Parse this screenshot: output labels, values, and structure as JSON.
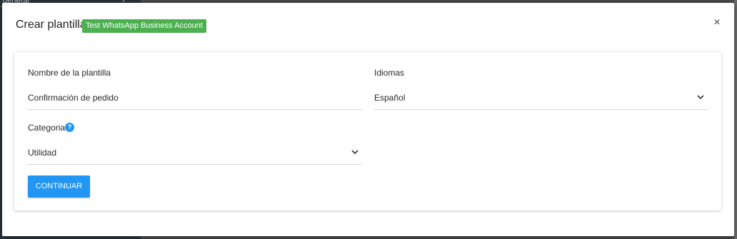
{
  "background": {
    "sidebar_text": "general",
    "sidebar_chevron": "›"
  },
  "modal": {
    "title": "Crear plantilla",
    "account_badge": "Test WhatsApp Business Account",
    "close_symbol": "×",
    "badge_color": "#4caf50"
  },
  "form": {
    "template_name": {
      "label": "Nombre de la plantilla",
      "value": "Confirmación de pedido"
    },
    "languages": {
      "label": "Idiomas",
      "value": "Español"
    },
    "category": {
      "label": "Categoria",
      "help_symbol": "?",
      "value": "Utilidad"
    },
    "continue_label": "CONTINUAR",
    "accent_color": "#2196f3"
  }
}
